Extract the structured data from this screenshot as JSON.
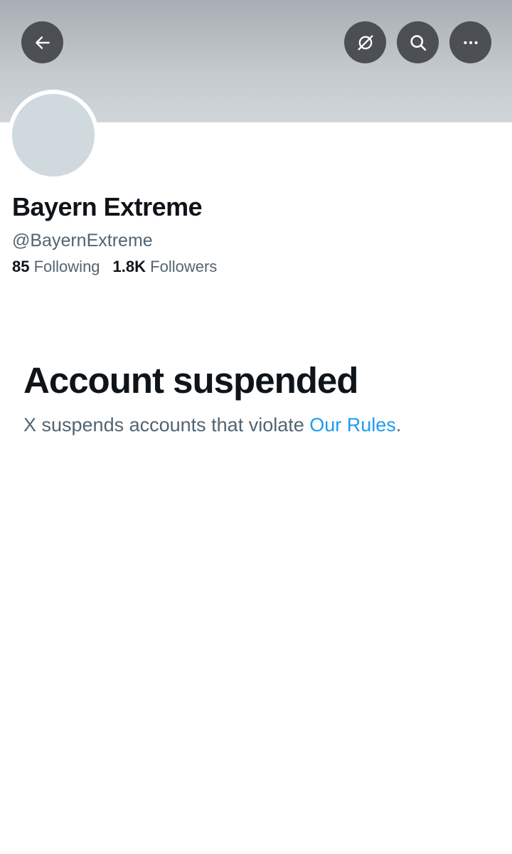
{
  "header": {
    "back_icon": "arrow-left-icon",
    "grok_icon": "grok-icon",
    "search_icon": "search-icon",
    "more_icon": "more-horizontal-icon"
  },
  "profile": {
    "display_name": "Bayern Extreme",
    "handle": "@BayernExtreme",
    "following_count": "85",
    "following_label": "Following",
    "followers_count": "1.8K",
    "followers_label": "Followers"
  },
  "suspension": {
    "title": "Account suspended",
    "message_prefix": "X suspends accounts that violate ",
    "rules_link": "Our Rules",
    "message_suffix": "."
  },
  "colors": {
    "link": "#1d9bf0",
    "primary_text": "#0f1419",
    "secondary_text": "#536471",
    "avatar_placeholder": "#cfd9de"
  }
}
